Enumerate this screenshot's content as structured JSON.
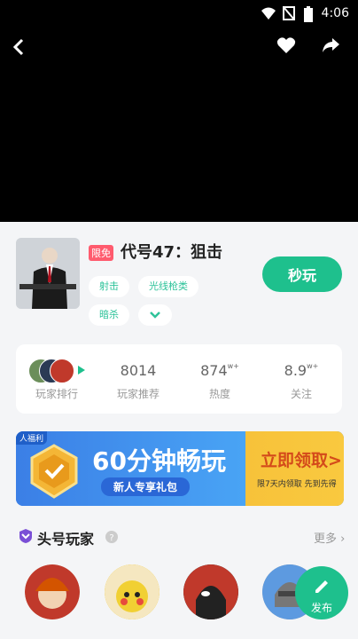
{
  "status_bar": {
    "time": "4:06"
  },
  "game": {
    "badge": "限免",
    "title": "代号47：狙击",
    "tags": [
      "射击",
      "光线枪类",
      "暗杀"
    ],
    "play_label": "秒玩"
  },
  "stats": {
    "rank_label": "玩家排行",
    "items": [
      {
        "value": "8014",
        "sup": "",
        "label": "玩家推荐"
      },
      {
        "value": "874",
        "sup": "w+",
        "label": "热度"
      },
      {
        "value": "8.9",
        "sup": "w+",
        "label": "关注"
      }
    ]
  },
  "banner": {
    "corner_tag": "人福利",
    "headline": "60分钟畅玩",
    "subline": "新人专享礼包",
    "cta": "立即领取>",
    "note": "限7天内领取 先到先得"
  },
  "players": {
    "title": "头号玩家",
    "more": "更多"
  },
  "fab": {
    "label": "发布"
  },
  "colors": {
    "accent": "#1ec08d",
    "badge": "#ff5b6e",
    "banner": "#3a8ef0"
  }
}
